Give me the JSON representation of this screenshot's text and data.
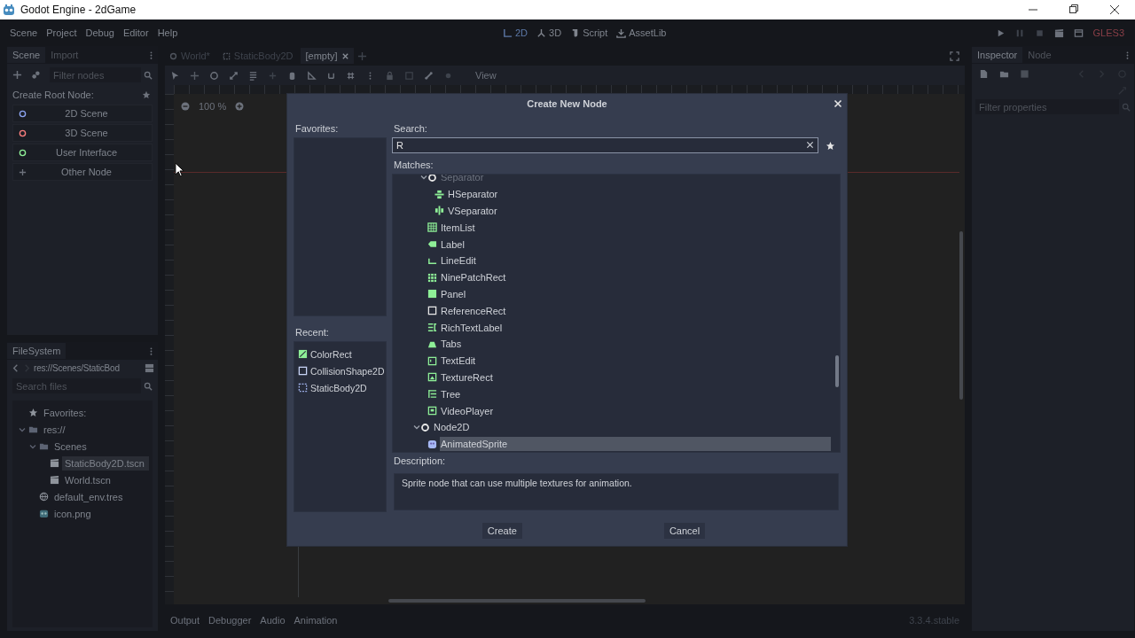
{
  "window": {
    "title": "Godot Engine - 2dGame"
  },
  "menu": [
    "Scene",
    "Project",
    "Debug",
    "Editor",
    "Help"
  ],
  "workspaces": [
    {
      "label": "2D",
      "selected": true,
      "kind": "twod"
    },
    {
      "label": "3D",
      "selected": false,
      "kind": "threed"
    },
    {
      "label": "Script",
      "selected": false,
      "kind": "script"
    },
    {
      "label": "AssetLib",
      "selected": false,
      "kind": "assetlib"
    }
  ],
  "renderer": "GLES3",
  "scene_dock": {
    "tabs": [
      {
        "label": "Scene",
        "selected": true
      },
      {
        "label": "Import",
        "selected": false
      }
    ],
    "filter": {
      "placeholder": "Filter nodes"
    },
    "heading": "Create Root Node:",
    "root_options": [
      {
        "label": "2D Scene",
        "kind": "circle",
        "color": "#8da5f3"
      },
      {
        "label": "3D Scene",
        "kind": "circle",
        "color": "#fc7f7f"
      },
      {
        "label": "User Interface",
        "kind": "circle",
        "color": "#8eef97"
      },
      {
        "label": "Other Node",
        "kind": "plus"
      }
    ]
  },
  "filesystem": {
    "title": "FileSystem",
    "path": "res://Scenes/StaticBod",
    "search": {
      "placeholder": "Search files"
    },
    "tree": [
      {
        "label": "Favorites:",
        "kind": "star",
        "selected": false
      },
      {
        "label": "res://",
        "kind": "folder",
        "selected": false,
        "expanded": true,
        "children": [
          {
            "label": "Scenes",
            "kind": "folder",
            "selected": false,
            "expanded": true,
            "children": [
              {
                "label": "StaticBody2D.tscn",
                "kind": "scene",
                "selected": true
              },
              {
                "label": "World.tscn",
                "kind": "scene",
                "selected": false
              }
            ]
          },
          {
            "label": "default_env.tres",
            "kind": "globe",
            "selected": false
          },
          {
            "label": "icon.png",
            "kind": "image",
            "selected": false
          }
        ]
      }
    ]
  },
  "scene_tabs": [
    {
      "label": "World*",
      "kind": "circle",
      "selected": false,
      "closable": false
    },
    {
      "label": "StaticBody2D",
      "kind": "body",
      "selected": false,
      "closable": false
    },
    {
      "label": "[empty]",
      "selected": true,
      "closable": true
    }
  ],
  "toolbar_view": "View",
  "zoom": "100 %",
  "inspector": {
    "tabs": [
      {
        "label": "Inspector",
        "selected": true
      },
      {
        "label": "Node",
        "selected": false
      }
    ],
    "filter": {
      "placeholder": "Filter properties"
    }
  },
  "bottom_tabs": [
    "Output",
    "Debugger",
    "Audio",
    "Animation"
  ],
  "version": "3.3.4.stable",
  "dialog": {
    "title": "Create New Node",
    "favorites_label": "Favorites:",
    "recent_label": "Recent:",
    "recent": [
      {
        "label": "ColorRect",
        "kind": "colorrect"
      },
      {
        "label": "CollisionShape2D",
        "kind": "collision"
      },
      {
        "label": "StaticBody2D",
        "kind": "body"
      }
    ],
    "search_label": "Search:",
    "search": {
      "value": "R"
    },
    "matches_label": "Matches:",
    "matches": {
      "continued": [
        {
          "label": "Separator",
          "kind": "circle",
          "selected": false,
          "disabled": true,
          "expanded": true,
          "children": [
            {
              "label": "HSeparator",
              "kind": "hsep",
              "selected": false,
              "disabled": false
            },
            {
              "label": "VSeparator",
              "kind": "vsep",
              "selected": false,
              "disabled": false
            }
          ]
        },
        {
          "label": "ItemList",
          "kind": "grid",
          "selected": false,
          "disabled": false
        },
        {
          "label": "Label",
          "kind": "tag",
          "selected": false,
          "disabled": false
        },
        {
          "label": "LineEdit",
          "kind": "line",
          "selected": false,
          "disabled": false
        },
        {
          "label": "NinePatchRect",
          "kind": "nine",
          "selected": false,
          "disabled": false
        },
        {
          "label": "Panel",
          "kind": "square",
          "selected": false,
          "disabled": false
        },
        {
          "label": "ReferenceRect",
          "kind": "frame",
          "selected": false,
          "disabled": false
        },
        {
          "label": "RichTextLabel",
          "kind": "richtext",
          "selected": false,
          "disabled": false
        },
        {
          "label": "Tabs",
          "kind": "tabs",
          "selected": false,
          "disabled": false
        },
        {
          "label": "TextEdit",
          "kind": "textedit",
          "selected": false,
          "disabled": false
        },
        {
          "label": "TextureRect",
          "kind": "texture",
          "selected": false,
          "disabled": false
        },
        {
          "label": "Tree",
          "kind": "tree",
          "selected": false,
          "disabled": false
        },
        {
          "label": "VideoPlayer",
          "kind": "video",
          "selected": false,
          "disabled": false
        }
      ],
      "rows": [
        {
          "label": "Node2D",
          "kind": "circle",
          "selected": false,
          "disabled": false,
          "expanded": true,
          "children": [
            {
              "label": "AnimatedSprite",
              "kind": "sprite",
              "selected": true,
              "disabled": false
            }
          ]
        }
      ]
    },
    "description_label": "Description:",
    "description": "Sprite node that can use multiple textures for animation.",
    "buttons": [
      "Create",
      "Cancel"
    ]
  }
}
